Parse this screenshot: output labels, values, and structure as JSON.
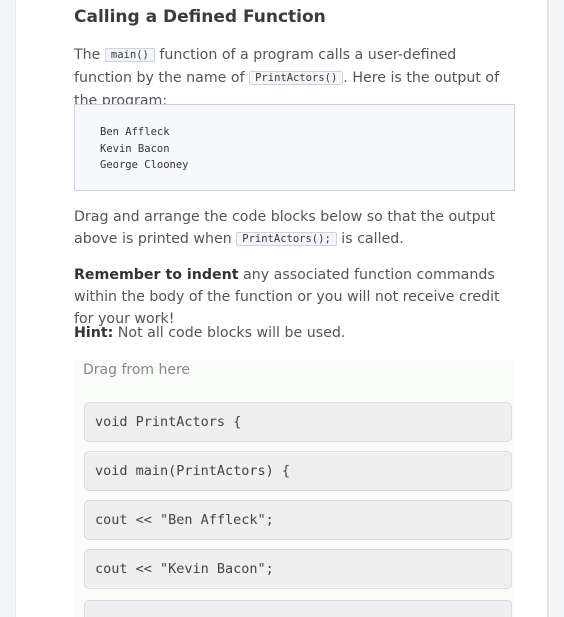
{
  "heading": "Calling a Defined Function",
  "intro": {
    "t1": "The ",
    "code1": "main()",
    "t2": " function of a program calls a user-defined function by the name of ",
    "code2": "PrintActors()",
    "t3": ". Here is the output of the program:"
  },
  "output_lines": [
    "Ben Affleck",
    "Kevin Bacon",
    "George Clooney"
  ],
  "instructions": {
    "t1": "Drag and arrange the code blocks below so that the output above is printed when ",
    "code": "PrintActors();",
    "t2": " is called."
  },
  "remember": {
    "bold": "Remember to indent",
    "rest": " any associated function commands within the body of the function or you will not receive credit for your work!"
  },
  "hint": {
    "bold": "Hint:",
    "rest": " Not all code blocks will be used."
  },
  "drag_area": {
    "title": "Drag from here",
    "blocks": [
      "void PrintActors {",
      "void main(PrintActors) {",
      "cout << \"Ben Affleck\";",
      "cout << \"Kevin Bacon\";"
    ]
  }
}
